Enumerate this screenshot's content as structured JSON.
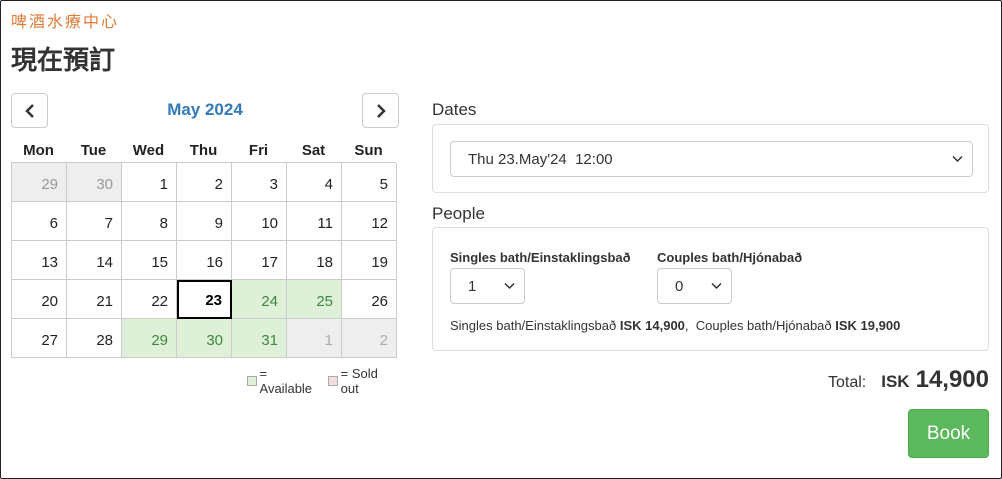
{
  "brand": "啤酒水療中心",
  "page_title": "現在預訂",
  "calendar": {
    "month_label": "May 2024",
    "weekdays": [
      "Mon",
      "Tue",
      "Wed",
      "Thu",
      "Fri",
      "Sat",
      "Sun"
    ],
    "days": [
      {
        "label": "29",
        "state": "outside"
      },
      {
        "label": "30",
        "state": "outside"
      },
      {
        "label": "1",
        "state": "normal"
      },
      {
        "label": "2",
        "state": "normal"
      },
      {
        "label": "3",
        "state": "normal"
      },
      {
        "label": "4",
        "state": "normal"
      },
      {
        "label": "5",
        "state": "normal"
      },
      {
        "label": "6",
        "state": "normal"
      },
      {
        "label": "7",
        "state": "normal"
      },
      {
        "label": "8",
        "state": "normal"
      },
      {
        "label": "9",
        "state": "normal"
      },
      {
        "label": "10",
        "state": "normal"
      },
      {
        "label": "11",
        "state": "normal"
      },
      {
        "label": "12",
        "state": "normal"
      },
      {
        "label": "13",
        "state": "normal"
      },
      {
        "label": "14",
        "state": "normal"
      },
      {
        "label": "15",
        "state": "normal"
      },
      {
        "label": "16",
        "state": "normal"
      },
      {
        "label": "17",
        "state": "normal"
      },
      {
        "label": "18",
        "state": "normal"
      },
      {
        "label": "19",
        "state": "normal"
      },
      {
        "label": "20",
        "state": "normal"
      },
      {
        "label": "21",
        "state": "normal"
      },
      {
        "label": "22",
        "state": "normal"
      },
      {
        "label": "23",
        "state": "selected"
      },
      {
        "label": "24",
        "state": "available"
      },
      {
        "label": "25",
        "state": "available"
      },
      {
        "label": "26",
        "state": "normal"
      },
      {
        "label": "27",
        "state": "normal"
      },
      {
        "label": "28",
        "state": "normal"
      },
      {
        "label": "29",
        "state": "available"
      },
      {
        "label": "30",
        "state": "available"
      },
      {
        "label": "31",
        "state": "available"
      },
      {
        "label": "1",
        "state": "soldout"
      },
      {
        "label": "2",
        "state": "soldout"
      }
    ],
    "legend": {
      "available": "= Available",
      "sold_out": "= Sold out"
    }
  },
  "dates": {
    "label": "Dates",
    "selected": "Thu 23.May'24  12:00"
  },
  "people": {
    "label": "People",
    "singles_label": "Singles bath/Einstaklingsbað",
    "singles_value": "1",
    "couples_label": "Couples bath/Hjónabað",
    "couples_value": "0",
    "singles_price_label": "Singles bath/Einstaklingsbað",
    "singles_price": "ISK 14,900",
    "couples_price_label": "Couples bath/Hjónabað",
    "couples_price": "ISK 19,900"
  },
  "total": {
    "label": "Total:",
    "currency": "ISK",
    "amount": "14,900"
  },
  "book_label": "Book",
  "colors": {
    "brand": "#e07b39",
    "month": "#337ab7",
    "available_bg": "#dff0d8",
    "sold_out_swatch": "#f2dede",
    "book_button": "#5cb85c"
  }
}
